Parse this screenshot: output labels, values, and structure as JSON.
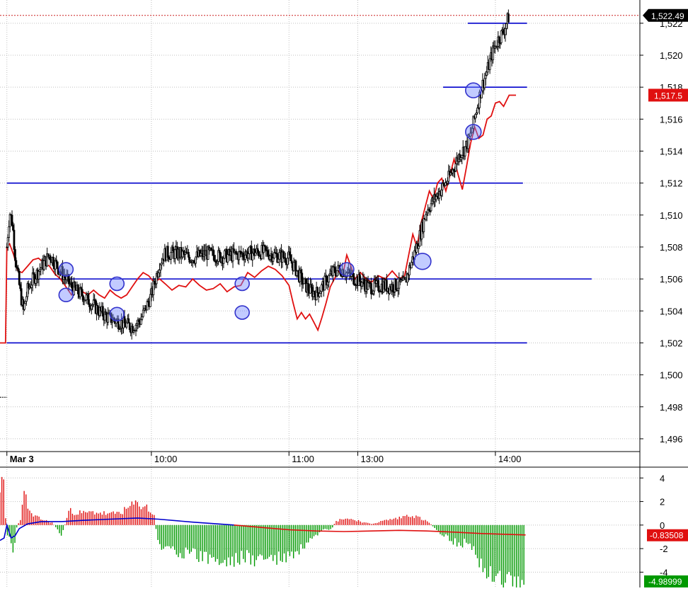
{
  "chart_data": [
    {
      "type": "candlestick",
      "panel": "price",
      "y_ticks": [
        "1,496",
        "1,498",
        "1,500",
        "1,502",
        "1,504",
        "1,506",
        "1,508",
        "1,510",
        "1,512",
        "1,514",
        "1,516",
        "1,518",
        "1,520",
        "1,522"
      ],
      "ylim": [
        1495.2,
        1523.1
      ],
      "x_labels": [
        "Mar 3",
        "10:00",
        "11:00",
        "13:00",
        "14:00"
      ],
      "x_label_times": [
        8.95,
        10.0,
        11.0,
        11.5,
        12.5
      ],
      "xlim": [
        8.9,
        13.55
      ],
      "last_price": 1522.49,
      "last_price_label": "1,522.49",
      "moving_average_label": "1,517.5",
      "moving_average_value": 1517.5,
      "horizontal_levels": [
        {
          "price": 1522.0,
          "from": 12.3,
          "to": 12.73
        },
        {
          "price": 1518.0,
          "from": 12.12,
          "to": 12.73
        },
        {
          "price": 1512.0,
          "from": 8.95,
          "to": 12.7
        },
        {
          "price": 1506.0,
          "from": 8.95,
          "to": 13.2
        },
        {
          "price": 1502.0,
          "from": 8.95,
          "to": 12.73
        }
      ],
      "price_path": [
        [
          8.95,
          1508.0
        ],
        [
          8.97,
          1510.2
        ],
        [
          8.99,
          1509.5
        ],
        [
          9.01,
          1507.5
        ],
        [
          9.03,
          1506.2
        ],
        [
          9.05,
          1505.0
        ],
        [
          9.07,
          1504.0
        ],
        [
          9.1,
          1505.3
        ],
        [
          9.14,
          1506.0
        ],
        [
          9.18,
          1506.5
        ],
        [
          9.22,
          1507.0
        ],
        [
          9.26,
          1507.5
        ],
        [
          9.3,
          1507.0
        ],
        [
          9.34,
          1506.5
        ],
        [
          9.38,
          1506.0
        ],
        [
          9.42,
          1505.5
        ],
        [
          9.46,
          1505.2
        ],
        [
          9.5,
          1505.0
        ],
        [
          9.55,
          1504.6
        ],
        [
          9.62,
          1504.0
        ],
        [
          9.68,
          1503.6
        ],
        [
          9.74,
          1503.4
        ],
        [
          9.8,
          1503.2
        ],
        [
          9.86,
          1503.0
        ],
        [
          9.92,
          1503.4
        ],
        [
          9.96,
          1504.2
        ],
        [
          10.0,
          1505.0
        ],
        [
          10.03,
          1506.0
        ],
        [
          10.06,
          1507.0
        ],
        [
          10.1,
          1507.6
        ],
        [
          10.2,
          1507.6
        ],
        [
          10.3,
          1507.3
        ],
        [
          10.4,
          1507.6
        ],
        [
          10.5,
          1507.4
        ],
        [
          10.6,
          1507.5
        ],
        [
          10.7,
          1507.6
        ],
        [
          10.8,
          1507.7
        ],
        [
          10.9,
          1507.5
        ],
        [
          11.0,
          1507.3
        ],
        [
          11.05,
          1506.6
        ],
        [
          11.1,
          1505.8
        ],
        [
          11.15,
          1505.3
        ],
        [
          11.2,
          1505.1
        ],
        [
          11.24,
          1505.5
        ],
        [
          11.28,
          1506.0
        ],
        [
          11.33,
          1506.5
        ],
        [
          11.38,
          1506.6
        ],
        [
          11.43,
          1506.3
        ],
        [
          11.48,
          1506.0
        ],
        [
          11.53,
          1505.8
        ],
        [
          11.58,
          1505.5
        ],
        [
          11.63,
          1505.5
        ],
        [
          11.68,
          1505.6
        ],
        [
          11.73,
          1505.5
        ],
        [
          11.78,
          1505.6
        ],
        [
          11.84,
          1505.7
        ],
        [
          11.88,
          1506.8
        ],
        [
          11.92,
          1507.8
        ],
        [
          11.96,
          1509.0
        ],
        [
          12.0,
          1510.3
        ],
        [
          12.04,
          1510.8
        ],
        [
          12.08,
          1511.3
        ],
        [
          12.12,
          1511.8
        ],
        [
          12.16,
          1512.3
        ],
        [
          12.2,
          1513.0
        ],
        [
          12.24,
          1513.8
        ],
        [
          12.28,
          1514.2
        ],
        [
          12.32,
          1515.0
        ],
        [
          12.36,
          1516.5
        ],
        [
          12.4,
          1518.0
        ],
        [
          12.44,
          1519.0
        ],
        [
          12.48,
          1520.2
        ],
        [
          12.52,
          1521.0
        ],
        [
          12.56,
          1521.5
        ],
        [
          12.6,
          1522.5
        ]
      ],
      "moving_average": [
        [
          8.9,
          1502.0
        ],
        [
          8.94,
          1502.0
        ],
        [
          8.95,
          1508.0
        ],
        [
          8.97,
          1508.2
        ],
        [
          9.0,
          1507.5
        ],
        [
          9.03,
          1506.5
        ],
        [
          9.06,
          1506.4
        ],
        [
          9.1,
          1506.8
        ],
        [
          9.14,
          1507.2
        ],
        [
          9.18,
          1507.3
        ],
        [
          9.22,
          1507.0
        ],
        [
          9.26,
          1506.8
        ],
        [
          9.3,
          1506.3
        ],
        [
          9.34,
          1506.0
        ],
        [
          9.38,
          1505.5
        ],
        [
          9.42,
          1505.0
        ],
        [
          9.46,
          1505.5
        ],
        [
          9.5,
          1505.2
        ],
        [
          9.54,
          1505.0
        ],
        [
          9.58,
          1505.3
        ],
        [
          9.62,
          1505.0
        ],
        [
          9.66,
          1504.8
        ],
        [
          9.7,
          1505.3
        ],
        [
          9.74,
          1505.0
        ],
        [
          9.78,
          1504.8
        ],
        [
          9.82,
          1505.0
        ],
        [
          9.86,
          1505.5
        ],
        [
          9.9,
          1506.0
        ],
        [
          9.94,
          1506.4
        ],
        [
          9.98,
          1506.2
        ],
        [
          10.02,
          1505.8
        ],
        [
          10.06,
          1506.0
        ],
        [
          10.1,
          1505.7
        ],
        [
          10.15,
          1505.3
        ],
        [
          10.2,
          1505.6
        ],
        [
          10.25,
          1505.5
        ],
        [
          10.3,
          1506.0
        ],
        [
          10.35,
          1505.6
        ],
        [
          10.4,
          1505.3
        ],
        [
          10.45,
          1505.4
        ],
        [
          10.5,
          1505.7
        ],
        [
          10.55,
          1505.2
        ],
        [
          10.6,
          1505.5
        ],
        [
          10.65,
          1505.6
        ],
        [
          10.7,
          1506.4
        ],
        [
          10.75,
          1506.1
        ],
        [
          10.8,
          1506.5
        ],
        [
          10.85,
          1506.8
        ],
        [
          10.9,
          1506.6
        ],
        [
          10.95,
          1506.2
        ],
        [
          11.0,
          1505.6
        ],
        [
          11.03,
          1504.5
        ],
        [
          11.06,
          1503.5
        ],
        [
          11.09,
          1503.9
        ],
        [
          11.12,
          1503.5
        ],
        [
          11.15,
          1503.8
        ],
        [
          11.18,
          1503.3
        ],
        [
          11.21,
          1502.8
        ],
        [
          11.24,
          1503.6
        ],
        [
          11.27,
          1504.5
        ],
        [
          11.3,
          1505.5
        ],
        [
          11.33,
          1506.0
        ],
        [
          11.36,
          1506.5
        ],
        [
          11.39,
          1506.2
        ],
        [
          11.42,
          1507.5
        ],
        [
          11.45,
          1506.8
        ],
        [
          11.48,
          1506.0
        ],
        [
          11.52,
          1506.4
        ],
        [
          11.56,
          1506.0
        ],
        [
          11.6,
          1505.8
        ],
        [
          11.65,
          1506.2
        ],
        [
          11.7,
          1506.0
        ],
        [
          11.75,
          1506.5
        ],
        [
          11.8,
          1506.0
        ],
        [
          11.84,
          1506.2
        ],
        [
          11.87,
          1507.5
        ],
        [
          11.9,
          1508.8
        ],
        [
          11.93,
          1508.0
        ],
        [
          11.96,
          1509.5
        ],
        [
          11.99,
          1510.5
        ],
        [
          12.02,
          1511.5
        ],
        [
          12.05,
          1511.0
        ],
        [
          12.08,
          1512.0
        ],
        [
          12.11,
          1512.3
        ],
        [
          12.14,
          1511.5
        ],
        [
          12.17,
          1512.5
        ],
        [
          12.2,
          1513.5
        ],
        [
          12.23,
          1512.5
        ],
        [
          12.26,
          1511.6
        ],
        [
          12.29,
          1513.0
        ],
        [
          12.32,
          1514.5
        ],
        [
          12.35,
          1515.5
        ],
        [
          12.38,
          1514.8
        ],
        [
          12.41,
          1515.0
        ],
        [
          12.44,
          1516.0
        ],
        [
          12.47,
          1516.2
        ],
        [
          12.5,
          1517.0
        ],
        [
          12.53,
          1517.1
        ],
        [
          12.56,
          1516.8
        ],
        [
          12.6,
          1517.5
        ],
        [
          12.65,
          1517.5
        ]
      ],
      "markers": [
        {
          "t": 9.38,
          "price": 1506.6
        },
        {
          "t": 9.38,
          "price": 1505.0
        },
        {
          "t": 9.75,
          "price": 1505.7
        },
        {
          "t": 9.75,
          "price": 1503.8
        },
        {
          "t": 10.66,
          "price": 1505.7
        },
        {
          "t": 10.66,
          "price": 1503.9
        },
        {
          "t": 11.42,
          "price": 1506.6
        },
        {
          "t": 11.97,
          "price": 1507.1
        },
        {
          "t": 12.34,
          "price": 1517.8
        },
        {
          "t": 12.34,
          "price": 1515.2
        }
      ],
      "colors": {
        "candles": "#000000",
        "average": "#e01010",
        "levels": "#0000cc",
        "markers": "#3333cc",
        "last_price_badge": "#000000",
        "average_badge": "#e01010"
      }
    },
    {
      "type": "histogram",
      "panel": "oscillator",
      "y_ticks": [
        "4",
        "2",
        "0",
        "-2",
        "-4"
      ],
      "ylim": [
        -5.3,
        4.8
      ],
      "xlim": [
        8.9,
        13.55
      ],
      "oscillator_label": "-0.83508",
      "oscillator_value": -0.83508,
      "histogram_label": "-4.98999",
      "histogram_value": -4.98999,
      "profile": [
        [
          8.9,
          3.4
        ],
        [
          8.93,
          3.3
        ],
        [
          8.94,
          0.6
        ],
        [
          8.95,
          -0.8
        ],
        [
          8.97,
          -1.0
        ],
        [
          9.0,
          -2.4
        ],
        [
          9.02,
          -0.3
        ],
        [
          9.05,
          0.6
        ],
        [
          9.08,
          2.8
        ],
        [
          9.12,
          0.9
        ],
        [
          9.2,
          0.5
        ],
        [
          9.28,
          0.2
        ],
        [
          9.35,
          -0.9
        ],
        [
          9.4,
          1.2
        ],
        [
          9.5,
          1.0
        ],
        [
          9.6,
          1.1
        ],
        [
          9.7,
          0.9
        ],
        [
          9.8,
          1.2
        ],
        [
          9.88,
          1.8
        ],
        [
          9.96,
          1.6
        ],
        [
          10.02,
          0.8
        ],
        [
          10.05,
          -1.7
        ],
        [
          10.15,
          -2.0
        ],
        [
          10.25,
          -2.4
        ],
        [
          10.35,
          -2.6
        ],
        [
          10.45,
          -2.9
        ],
        [
          10.55,
          -3.2
        ],
        [
          10.65,
          -2.7
        ],
        [
          10.75,
          -2.9
        ],
        [
          10.85,
          -2.8
        ],
        [
          10.95,
          -2.9
        ],
        [
          11.05,
          -2.5
        ],
        [
          11.1,
          -1.9
        ],
        [
          11.15,
          -1.5
        ],
        [
          11.2,
          -1.0
        ],
        [
          11.25,
          -0.4
        ],
        [
          11.3,
          -0.5
        ],
        [
          11.34,
          0.3
        ],
        [
          11.4,
          0.6
        ],
        [
          11.45,
          0.5
        ],
        [
          11.5,
          0.4
        ],
        [
          11.55,
          0.2
        ],
        [
          11.6,
          0.1
        ],
        [
          11.7,
          0.4
        ],
        [
          11.8,
          0.6
        ],
        [
          11.88,
          0.9
        ],
        [
          11.95,
          0.6
        ],
        [
          12.02,
          0.2
        ],
        [
          12.08,
          -0.5
        ],
        [
          12.15,
          -1.0
        ],
        [
          12.22,
          -1.6
        ],
        [
          12.3,
          -1.5
        ],
        [
          12.36,
          -2.5
        ],
        [
          12.42,
          -3.6
        ],
        [
          12.48,
          -4.3
        ],
        [
          12.54,
          -4.7
        ],
        [
          12.6,
          -4.8
        ],
        [
          12.7,
          -5.0
        ]
      ],
      "signal_line": [
        [
          8.9,
          -1.3
        ],
        [
          8.93,
          -1.1
        ],
        [
          8.95,
          0.0
        ],
        [
          8.98,
          -1.1
        ],
        [
          9.01,
          -0.9
        ],
        [
          9.04,
          -0.3
        ],
        [
          9.1,
          0.1
        ],
        [
          9.2,
          0.3
        ],
        [
          9.35,
          0.3
        ],
        [
          9.5,
          0.4
        ],
        [
          9.7,
          0.5
        ],
        [
          9.9,
          0.6
        ],
        [
          10.05,
          0.5
        ],
        [
          10.3,
          0.25
        ],
        [
          10.6,
          0.0
        ],
        [
          10.8,
          -0.2
        ],
        [
          11.0,
          -0.4
        ],
        [
          11.2,
          -0.5
        ],
        [
          11.4,
          -0.55
        ],
        [
          11.6,
          -0.5
        ],
        [
          11.8,
          -0.45
        ],
        [
          12.0,
          -0.5
        ],
        [
          12.2,
          -0.6
        ],
        [
          12.4,
          -0.72
        ],
        [
          12.6,
          -0.8
        ],
        [
          12.72,
          -0.84
        ]
      ],
      "colors": {
        "positive_bars": "#e01010",
        "negative_bars": "#009900",
        "signal": "#e01010",
        "early_signal": "#0000cc"
      }
    }
  ]
}
